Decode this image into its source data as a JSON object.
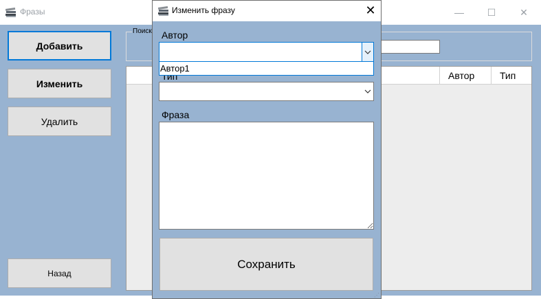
{
  "main_window": {
    "title": "Фразы",
    "controls": {
      "minimize": "—",
      "maximize": "☐",
      "close": "✕"
    },
    "buttons": {
      "add": "Добавить",
      "edit": "Изменить",
      "delete": "Удалить",
      "back": "Назад"
    },
    "search": {
      "group_label": "Поиск",
      "value": ""
    },
    "table": {
      "columns": [
        "Автор",
        "Тип"
      ]
    }
  },
  "dialog": {
    "title": "Изменить фразу",
    "close": "✕",
    "author": {
      "label": "Автор",
      "value": "",
      "options": [
        "Автор1"
      ]
    },
    "type": {
      "label": "Тип",
      "value": ""
    },
    "phrase": {
      "label": "Фраза",
      "value": ""
    },
    "save_button": "Сохранить"
  },
  "icons": {
    "app": "books-stack-icon",
    "dropdown": "chevron-down-icon"
  },
  "colors": {
    "client_bg": "#98b3d1",
    "button_bg": "#e1e1e1",
    "focus": "#0078d7"
  }
}
